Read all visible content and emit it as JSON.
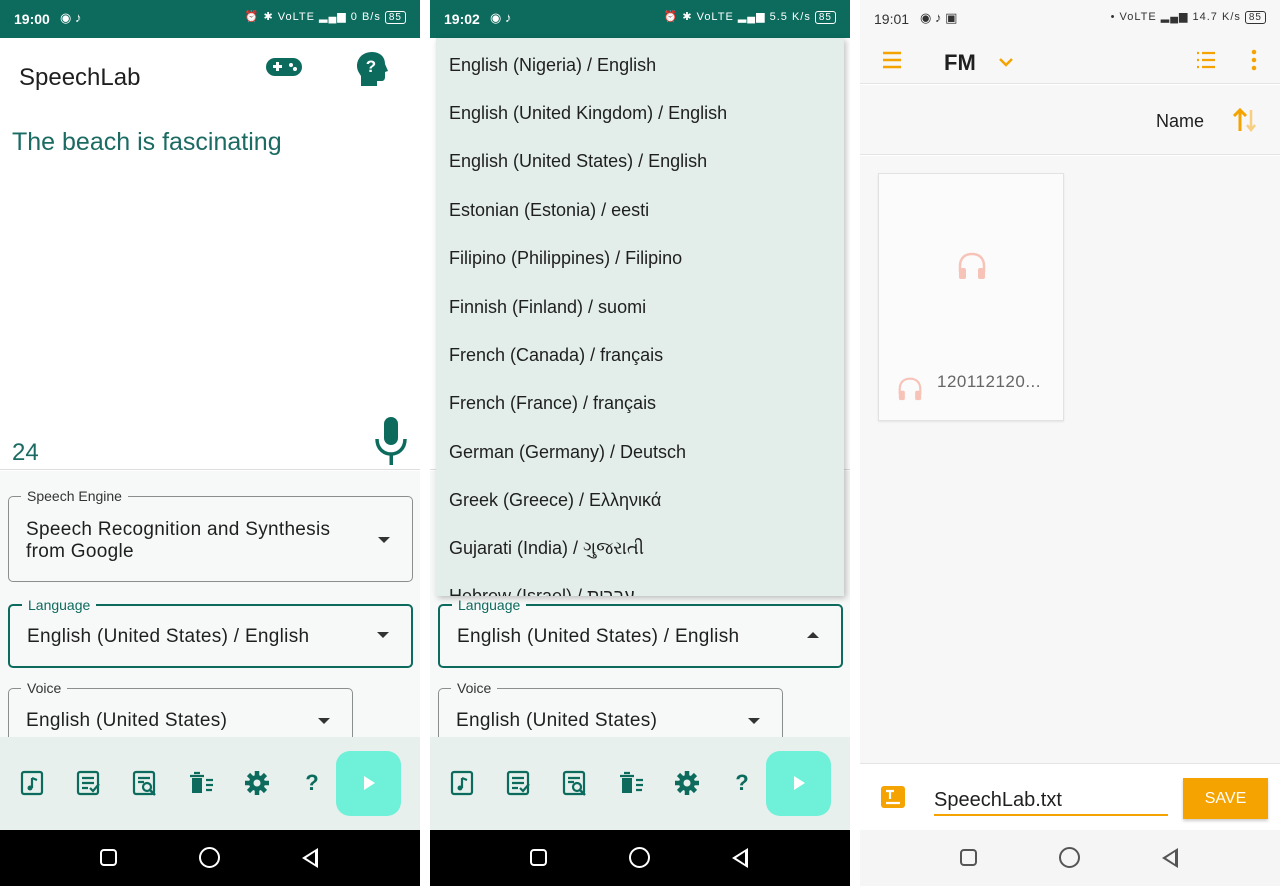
{
  "colors": {
    "teal": "#0d6b5e",
    "accent_mint": "#6ff0d8",
    "orange": "#f5a300"
  },
  "panel1": {
    "status": {
      "time": "19:00",
      "net_speed": "0 B/s",
      "battery": "85"
    },
    "app_title": "SpeechLab",
    "header_icons": [
      "gamepad-icon",
      "help-head-icon"
    ],
    "recognized_text": "The beach is fascinating",
    "char_count": "24",
    "fields": {
      "engine": {
        "label": "Speech Engine",
        "value": "Speech Recognition and Synthesis from Google"
      },
      "language": {
        "label": "Language",
        "value": "English (United States) / English"
      },
      "voice": {
        "label": "Voice",
        "value": "English (United States)"
      }
    },
    "toolbar_icons": [
      "music-file-icon",
      "edit-list-icon",
      "search-doc-icon",
      "delete-list-icon",
      "gear-icon",
      "help-icon",
      "play-icon"
    ],
    "help_glyph": "?"
  },
  "panel2": {
    "status": {
      "time": "19:02",
      "net_speed": "5.5 K/s",
      "battery": "85"
    },
    "dropdown_items": [
      "English (Nigeria) / English",
      "English (United Kingdom) / English",
      "English (United States) / English",
      "Estonian (Estonia) / eesti",
      "Filipino (Philippines) / Filipino",
      "Finnish (Finland) / suomi",
      "French (Canada) / français",
      "French (France) / français",
      "German (Germany) / Deutsch",
      "Greek (Greece) / Ελληνικά",
      "Gujarati (India) / ગુજરાતી",
      "Hebrew (Israel) / עברית"
    ],
    "fields": {
      "language": {
        "label": "Language",
        "value": "English (United States) / English"
      },
      "voice": {
        "label": "Voice",
        "value": "English (United States)"
      }
    },
    "help_glyph": "?"
  },
  "panel3": {
    "status": {
      "time": "19:01",
      "net_speed": "14.7 K/s",
      "battery": "85"
    },
    "title": "FM",
    "sort_label": "Name",
    "file_name": "120112120...",
    "filename_value": "SpeechLab.txt",
    "save_label": "SAVE"
  }
}
